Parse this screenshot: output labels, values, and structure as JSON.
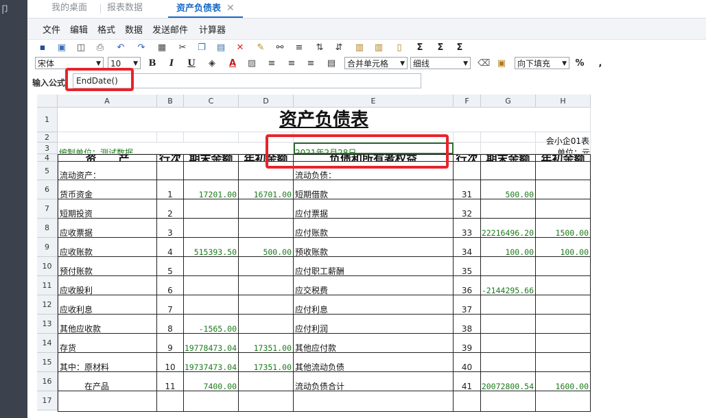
{
  "tabs": [
    {
      "label": "我的桌面"
    },
    {
      "label": "报表数据"
    },
    {
      "label": "资产负债表"
    }
  ],
  "menu": [
    "文件",
    "编辑",
    "格式",
    "数据",
    "发送邮件",
    "计算器"
  ],
  "toolbar2": {
    "font_name": "宋体",
    "font_size": "10",
    "bold": "B",
    "italic": "I",
    "underline": "U",
    "merge": "合并单元格",
    "border": "细线",
    "fill": "向下填充",
    "percent": "%",
    "comma": ","
  },
  "formula": {
    "label": "输入公式",
    "value": "EndDate()"
  },
  "columns": [
    "A",
    "B",
    "C",
    "D",
    "E",
    "F",
    "G",
    "H"
  ],
  "sheet": {
    "title": "资产负债表",
    "form_code": "会小企01表",
    "unit_label": "编制单位：测试数据",
    "date": "2021年2月28日",
    "currency": "单位：元",
    "headers": [
      "资　　产",
      "行次",
      "期末余额",
      "年初余额",
      "负债和所有者权益",
      "行次",
      "期末余额",
      "年初余额"
    ],
    "rows": [
      [
        "流动资产：",
        "",
        "",
        "",
        "流动负债：",
        "",
        "",
        ""
      ],
      [
        "货币资金",
        "1",
        "17201.00",
        "16701.00",
        "短期借款",
        "31",
        "500.00",
        ""
      ],
      [
        "短期投资",
        "2",
        "",
        "",
        "应付票据",
        "32",
        "",
        ""
      ],
      [
        "应收票据",
        "3",
        "",
        "",
        "应付账款",
        "33",
        "22216496.20",
        "1500.00"
      ],
      [
        "应收账款",
        "4",
        "515393.50",
        "500.00",
        "预收账款",
        "34",
        "100.00",
        "100.00"
      ],
      [
        "预付账款",
        "5",
        "",
        "",
        "应付职工薪酬",
        "35",
        "",
        ""
      ],
      [
        "应收股利",
        "6",
        "",
        "",
        "应交税费",
        "36",
        "-2144295.66",
        ""
      ],
      [
        "应收利息",
        "7",
        "",
        "",
        "应付利息",
        "37",
        "",
        ""
      ],
      [
        "其他应收款",
        "8",
        "-1565.00",
        "",
        "应付利润",
        "38",
        "",
        ""
      ],
      [
        "存货",
        "9",
        "19778473.04",
        "17351.00",
        "其他应付款",
        "39",
        "",
        ""
      ],
      [
        "其中：原材料",
        "10",
        "19737473.04",
        "17351.00",
        "其他流动负债",
        "40",
        "",
        ""
      ],
      [
        "　　　在产品",
        "11",
        "7400.00",
        "",
        "流动负债合计",
        "41",
        "20072800.54",
        "1600.00"
      ]
    ]
  },
  "row_numbers": [
    "1",
    "2",
    "3",
    "4",
    "5",
    "6",
    "7",
    "8",
    "9",
    "10",
    "11",
    "12",
    "13",
    "14",
    "15",
    "16",
    "17"
  ]
}
